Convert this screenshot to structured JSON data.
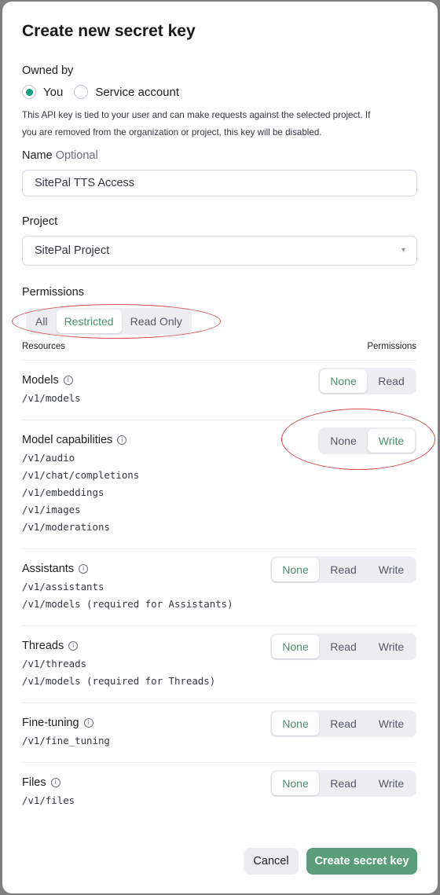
{
  "modal": {
    "title": "Create new secret key",
    "owned_by_label": "Owned by",
    "owner_options": [
      {
        "label": "You",
        "selected": true
      },
      {
        "label": "Service account",
        "selected": false
      }
    ],
    "help_line1": "This API key is tied to your user and can make requests against the selected project. If",
    "help_line2": "you are removed from the organization or project, this key will be disabled.",
    "name_label": "Name",
    "name_optional": "Optional",
    "name_value": "SitePal TTS Access",
    "project_label": "Project",
    "project_value": "SitePal Project",
    "permissions_label": "Permissions",
    "permission_modes": [
      "All",
      "Restricted",
      "Read Only"
    ],
    "permission_mode_selected": "Restricted",
    "resources_header": "Resources",
    "permissions_header": "Permissions",
    "resources": [
      {
        "name": "Models",
        "paths": [
          "/v1/models"
        ],
        "options": [
          "None",
          "Read"
        ],
        "selected": "None"
      },
      {
        "name": "Model capabilities",
        "paths": [
          "/v1/audio",
          "/v1/chat/completions",
          "/v1/embeddings",
          "/v1/images",
          "/v1/moderations"
        ],
        "options": [
          "None",
          "Write"
        ],
        "selected": "Write"
      },
      {
        "name": "Assistants",
        "paths": [
          "/v1/assistants",
          "/v1/models (required for Assistants)"
        ],
        "options": [
          "None",
          "Read",
          "Write"
        ],
        "selected": "None"
      },
      {
        "name": "Threads",
        "paths": [
          "/v1/threads",
          "/v1/models (required for Threads)"
        ],
        "options": [
          "None",
          "Read",
          "Write"
        ],
        "selected": "None"
      },
      {
        "name": "Fine-tuning",
        "paths": [
          "/v1/fine_tuning"
        ],
        "options": [
          "None",
          "Read",
          "Write"
        ],
        "selected": "None"
      },
      {
        "name": "Files",
        "paths": [
          "/v1/files"
        ],
        "options": [
          "None",
          "Read",
          "Write"
        ],
        "selected": "None"
      }
    ],
    "cancel_label": "Cancel",
    "create_label": "Create secret key"
  },
  "colors": {
    "accent": "#10a37f",
    "active_text": "#4a8f6e",
    "create_button": "#5a9d7a",
    "annotation_ring": "#d94a4a"
  },
  "icons": {
    "info": "info-circle-icon",
    "select_caret": "chevron-up-down-icon"
  }
}
